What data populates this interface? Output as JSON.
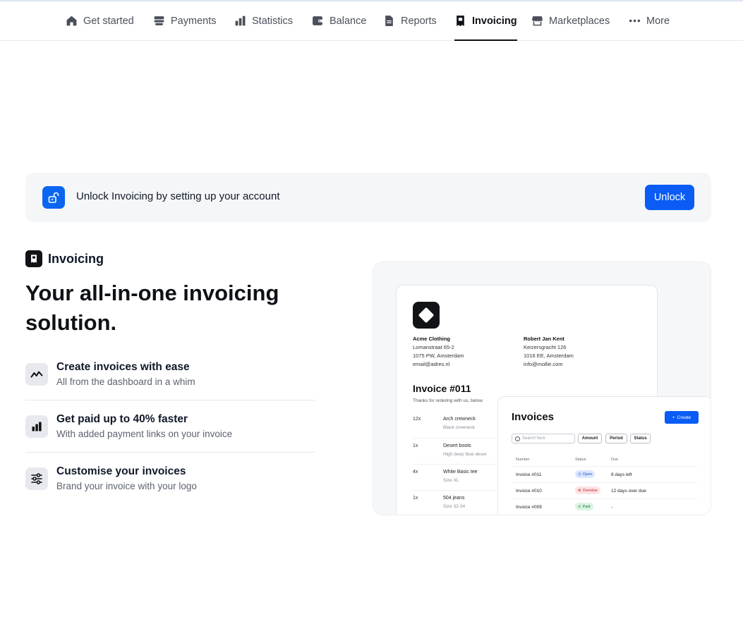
{
  "nav": {
    "items": [
      {
        "label": "Get started",
        "icon": "home-icon"
      },
      {
        "label": "Payments",
        "icon": "payments-icon"
      },
      {
        "label": "Statistics",
        "icon": "bar-chart-icon"
      },
      {
        "label": "Balance",
        "icon": "wallet-icon"
      },
      {
        "label": "Reports",
        "icon": "document-icon"
      },
      {
        "label": "Invoicing",
        "icon": "invoice-icon",
        "active": true
      },
      {
        "label": "Marketplaces",
        "icon": "store-icon"
      },
      {
        "label": "More",
        "icon": "ellipsis-icon"
      }
    ]
  },
  "banner": {
    "icon": "unlock-icon",
    "text": "Unlock Invoicing by setting up your account",
    "button_label": "Unlock",
    "accent": "#0a5cf5"
  },
  "product": {
    "label": "Invoicing",
    "headline": "Your all-in-one invoicing solution."
  },
  "features": [
    {
      "icon": "trend-icon",
      "title": "Create invoices with ease",
      "subtitle": "All from the dashboard in a whim"
    },
    {
      "icon": "bar-chart-icon",
      "title": "Get paid up to 40% faster",
      "subtitle": "With added payment links on your invoice"
    },
    {
      "icon": "sliders-icon",
      "title": "Customise your invoices",
      "subtitle": "Brand your invoice with your logo"
    }
  ],
  "preview": {
    "sender": {
      "name": "Acme Clothing",
      "street": "Lomanstraat 65-2",
      "city": "1075 PW, Amsterdam",
      "email": "email@adres.nl"
    },
    "recipient": {
      "name": "Robert Jan Kent",
      "street": "Keizersgracht 126",
      "city": "1016 EE, Amsterdam",
      "email": "info@mollie.com"
    },
    "invoice_number": "Invoice #011",
    "thanks": "Thanks for ordering with us, below",
    "line_items": [
      {
        "qty": "12x",
        "name": "Arch crewneck",
        "variant": "Black crewneck"
      },
      {
        "qty": "1x",
        "name": "Desert boots",
        "variant": "High deep blue deser"
      },
      {
        "qty": "4x",
        "name": "White Basic tee",
        "variant": "Size XL"
      },
      {
        "qty": "1x",
        "name": "504 jeans",
        "variant": "Size 32-34"
      }
    ],
    "list": {
      "title": "Invoices",
      "create_label": "Create",
      "search_placeholder": "Search here",
      "filters": [
        "Amount",
        "Period",
        "Status"
      ],
      "columns": [
        "Number",
        "Status",
        "Due"
      ],
      "rows": [
        {
          "number": "Invoice #011",
          "status": "Open",
          "status_type": "open",
          "due": "8 days left"
        },
        {
          "number": "Invoice #010",
          "status": "Overdue",
          "status_type": "overdue",
          "due": "12 days over due"
        },
        {
          "number": "Invoice #009",
          "status": "Paid",
          "status_type": "paid",
          "due": "-"
        }
      ]
    }
  }
}
